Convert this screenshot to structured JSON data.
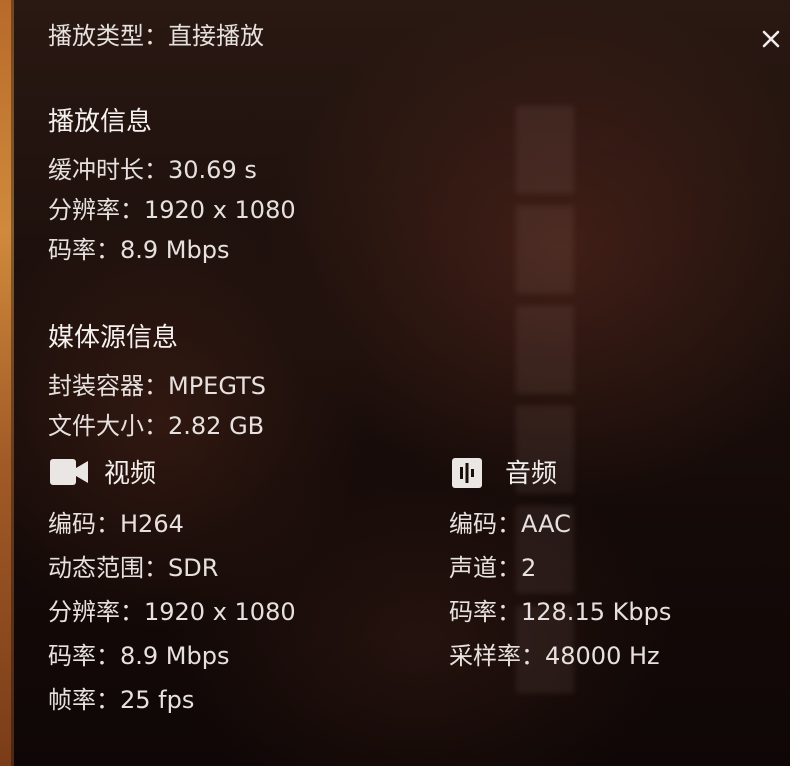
{
  "playback_type": {
    "label": "播放类型：",
    "value": "直接播放"
  },
  "playback_info": {
    "heading": "播放信息",
    "rows": [
      {
        "label": "缓冲时长：",
        "value": "30.69 s"
      },
      {
        "label": "分辨率：",
        "value": "1920 x 1080"
      },
      {
        "label": "码率：",
        "value": "8.9 Mbps"
      }
    ]
  },
  "media_source": {
    "heading": "媒体源信息",
    "rows": [
      {
        "label": "封装容器：",
        "value": "MPEGTS"
      },
      {
        "label": "文件大小：",
        "value": "2.82 GB"
      }
    ]
  },
  "video": {
    "heading": "视频",
    "icon": "video-camera-icon",
    "rows": [
      {
        "label": "编码：",
        "value": "H264"
      },
      {
        "label": "动态范围：",
        "value": "SDR"
      },
      {
        "label": "分辨率：",
        "value": "1920 x 1080"
      },
      {
        "label": "码率：",
        "value": "8.9 Mbps"
      },
      {
        "label": "帧率：",
        "value": "25 fps"
      }
    ]
  },
  "audio": {
    "heading": "音频",
    "icon": "audio-waveform-icon",
    "rows": [
      {
        "label": "编码：",
        "value": "AAC"
      },
      {
        "label": "声道：",
        "value": "2"
      },
      {
        "label": "码率：",
        "value": "128.15 Kbps"
      },
      {
        "label": "采样率：",
        "value": "48000 Hz"
      }
    ]
  },
  "close_icon": "close-icon"
}
